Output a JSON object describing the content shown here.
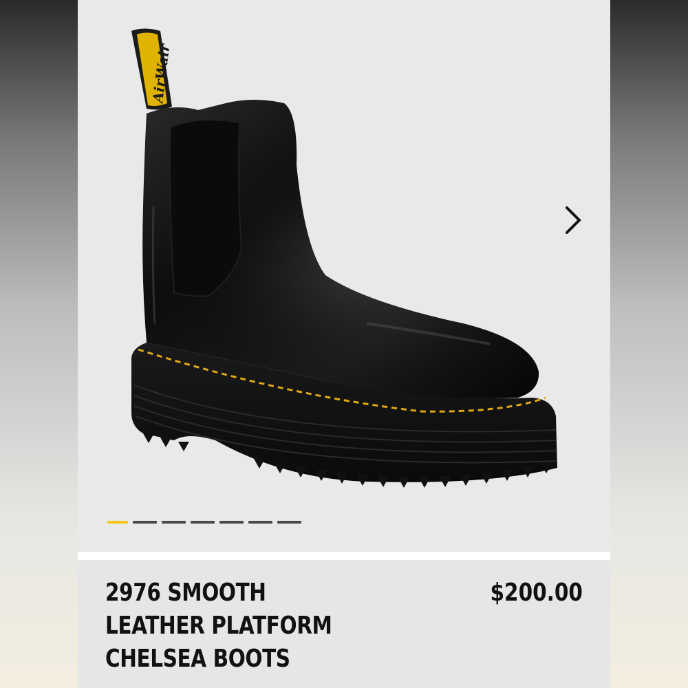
{
  "product": {
    "title": "2976 SMOOTH LEATHER PLATFORM CHELSEA BOOTS",
    "price": "$200.00",
    "image_icon": "black-platform-chelsea-boot-image",
    "pull_tab_text": "AirWair"
  },
  "gallery": {
    "next_icon": "chevron-right-icon",
    "slides": 7,
    "active_slide": 1
  },
  "colors": {
    "indicator_active": "#f5c518",
    "indicator_inactive": "#4a4a4a",
    "stitching": "#e0a812"
  }
}
